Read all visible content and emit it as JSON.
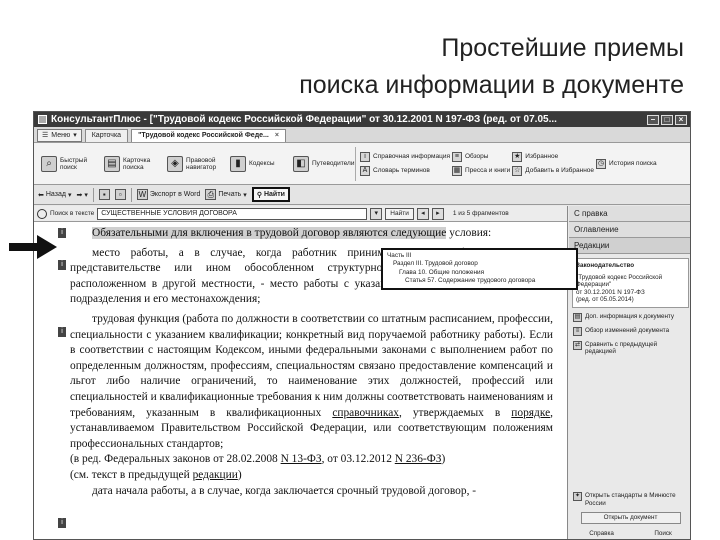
{
  "slide": {
    "title_line1": "Простейшие приемы",
    "title_line2": "поиска информации в документе"
  },
  "window": {
    "title": "КонсультантПлюс - [\"Трудовой кодекс Российской Федерации\" от 30.12.2001 N 197-ФЗ (ред. от 07.05...",
    "controls": [
      "–",
      "□",
      "×"
    ]
  },
  "tabs": {
    "menu_label": "Меню",
    "items": [
      {
        "label": "Карточка"
      },
      {
        "label": "\"Трудовой кодекс Российской Феде..."
      }
    ]
  },
  "ribbon": {
    "buttons": [
      {
        "label": "Быстрый поиск"
      },
      {
        "label": "Карточка поиска"
      },
      {
        "label": "Правовой навигатор"
      },
      {
        "label": "Кодексы"
      },
      {
        "label": "Путеводители"
      }
    ],
    "links_col1": [
      "Справочная информация",
      "Словарь терминов"
    ],
    "links_col2": [
      "Обзоры",
      "Пресса и книги"
    ],
    "links_col3": [
      "Избранное",
      "Добавить в Избранное"
    ],
    "links_col4": [
      "История поиска"
    ]
  },
  "toolbar": {
    "back": "Назад",
    "word": "Экспорт в Word",
    "print": "Печать",
    "find": "Найти"
  },
  "search": {
    "label": "Поиск в тексте",
    "value": "СУЩЕСТВЕННЫЕ УСЛОВИЯ ДОГОВОРА",
    "find_button": "Найти",
    "count": "1 из 5 фрагментов"
  },
  "document": {
    "p1_highlight": "Обязательными для включения в трудовой договор являются следующие",
    "p1_rest": "условия:",
    "p2": "место работы, а в случае, когда работник принимается для работы в филиале, представительстве или ином обособленном структурном подразделении организации, расположенном в другой местности, - место работы с указанием обособленного структурного подразделения и его местонахождения;",
    "p3_part1": "трудовая функция (работа по должности в соответствии со штатным расписанием, профессии, специальности с указанием квалификации; конкретный вид поручаемой работнику работы). Если в соответствии с настоящим Кодексом, иными федеральными законами с выполнением работ по определенным должностям, профессиям, специальностям связано предоставление компенсаций и льгот либо наличие ограничений, то наименование этих должностей, профессий или специальностей и квалификационные требования к ним должны соответствовать наименованиям и требованиям, указанным в квалификационных",
    "p3_link1": "справочниках",
    "p3_part2": ", утверждаемых в",
    "p3_link2": "порядке",
    "p3_part3": ", устанавливаемом Правительством Российской Федерации, или соответствующим положениям профессиональных стандартов;",
    "p3_ed_pre": "(в ред. Федеральных законов от 28.02.2008",
    "p3_ed_link1": "N 13-ФЗ",
    "p3_ed_mid": ", от 03.12.2012",
    "p3_ed_link2": "N 236-ФЗ",
    "p3_ed_post": ")",
    "p3_prev_pre": "(см. текст в предыдущей",
    "p3_prev_link": "редакции",
    "p3_prev_post": ")",
    "p4": "дата начала работы, а в случае, когда заключается срочный трудовой договор, -"
  },
  "popup": {
    "lines": [
      "Часть III",
      "Раздел III. Трудовой договор",
      "Глава 10. Общие положения",
      "Статья 57. Содержание трудового договора"
    ]
  },
  "sidepanel": {
    "tabs": [
      "С правка",
      "Оглавление",
      "Редакции"
    ],
    "box_title": "Законодательство",
    "box_text1": "\"Трудовой кодекс Российской Федерации\"",
    "box_text2": "от 30.12.2001 N 197-ФЗ",
    "box_text3": "(ред. от 05.05.2014)",
    "items": [
      "Доп. информация к документу",
      "Обзор изменений документа",
      "Сравнить с предыдущей редакцией"
    ],
    "bottom_item": "Открыть стандарты в Минюсте России",
    "bottom_button": "Открыть документ",
    "footer_left": "Справка",
    "footer_right": "Поиск"
  }
}
